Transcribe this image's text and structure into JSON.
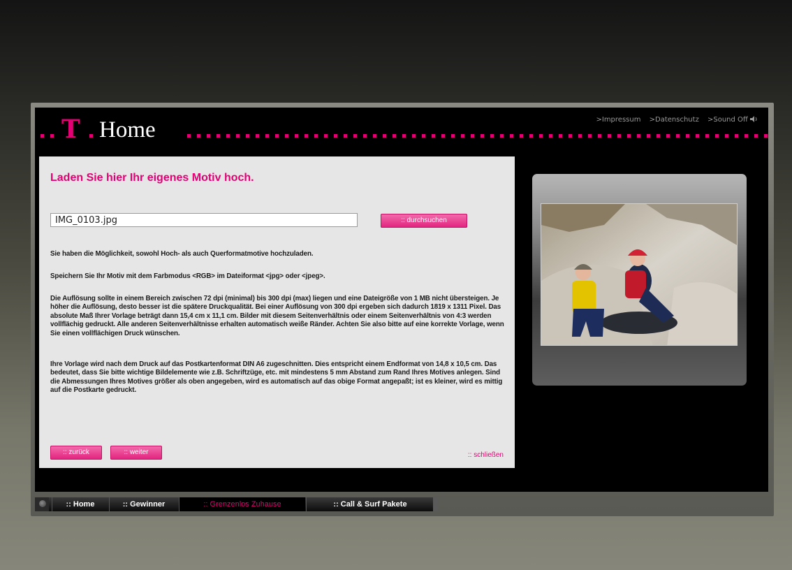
{
  "header": {
    "logo_t": "T",
    "logo_home": "Home",
    "links": [
      ">Impressum",
      ">Datenschutz",
      ">Sound Off"
    ]
  },
  "panel": {
    "title": "Laden Sie hier Ihr eigenes Motiv hoch.",
    "file_value": "IMG_0103.jpg",
    "browse_label": ":: durchsuchen",
    "paragraphs": [
      "Sie haben die Möglichkeit, sowohl Hoch- als auch Querformatmotive hochzuladen.",
      "Speichern Sie Ihr Motiv mit dem Farbmodus <RGB> im Dateiformat <jpg> oder <jpeg>.",
      "Die Auflösung sollte in einem Bereich zwischen 72 dpi (minimal) bis 300 dpi (max) liegen und eine Dateigröße von 1 MB nicht übersteigen. Je höher die Auflösung, desto besser ist die spätere Druckqualität. Bei einer Auflösung von 300 dpi ergeben sich dadurch 1819 x 1311 Pixel. Das absolute Maß Ihrer Vorlage beträgt dann 15,4 cm x 11,1 cm. Bilder mit diesem Seitenverhältnis oder einem Seitenverhältnis von 4:3 werden vollflächig gedruckt. Alle anderen Seitenverhältnisse erhalten automatisch weiße Ränder. Achten Sie also bitte auf eine korrekte Vorlage, wenn Sie einen vollflächigen Druck wünschen.",
      "Ihre Vorlage wird nach dem Druck auf das Postkartenformat DIN A6 zugeschnitten. Dies entspricht einem Endformat von 14,8 x 10,5 cm. Das bedeutet, dass Sie bitte wichtige Bildelemente wie z.B. Schriftzüge, etc. mit mindestens 5 mm Abstand zum Rand Ihres Motives anlegen. Sind die Abmessungen Ihres Motives größer als oben angegeben, wird es automatisch auf das obige Format angepaßt; ist es kleiner, wird es mittig auf die Postkarte gedruckt."
    ],
    "back_label": ":: zurück",
    "next_label": ":: weiter",
    "close_label": ":: schließen"
  },
  "nav": {
    "items": [
      ":: Home",
      ":: Gewinner",
      ":: Grenzenlos Zuhause",
      ":: Call & Surf Pakete"
    ],
    "active_index": 2
  },
  "colors": {
    "magenta": "#e20074",
    "panel_bg": "#e6e6e6"
  }
}
